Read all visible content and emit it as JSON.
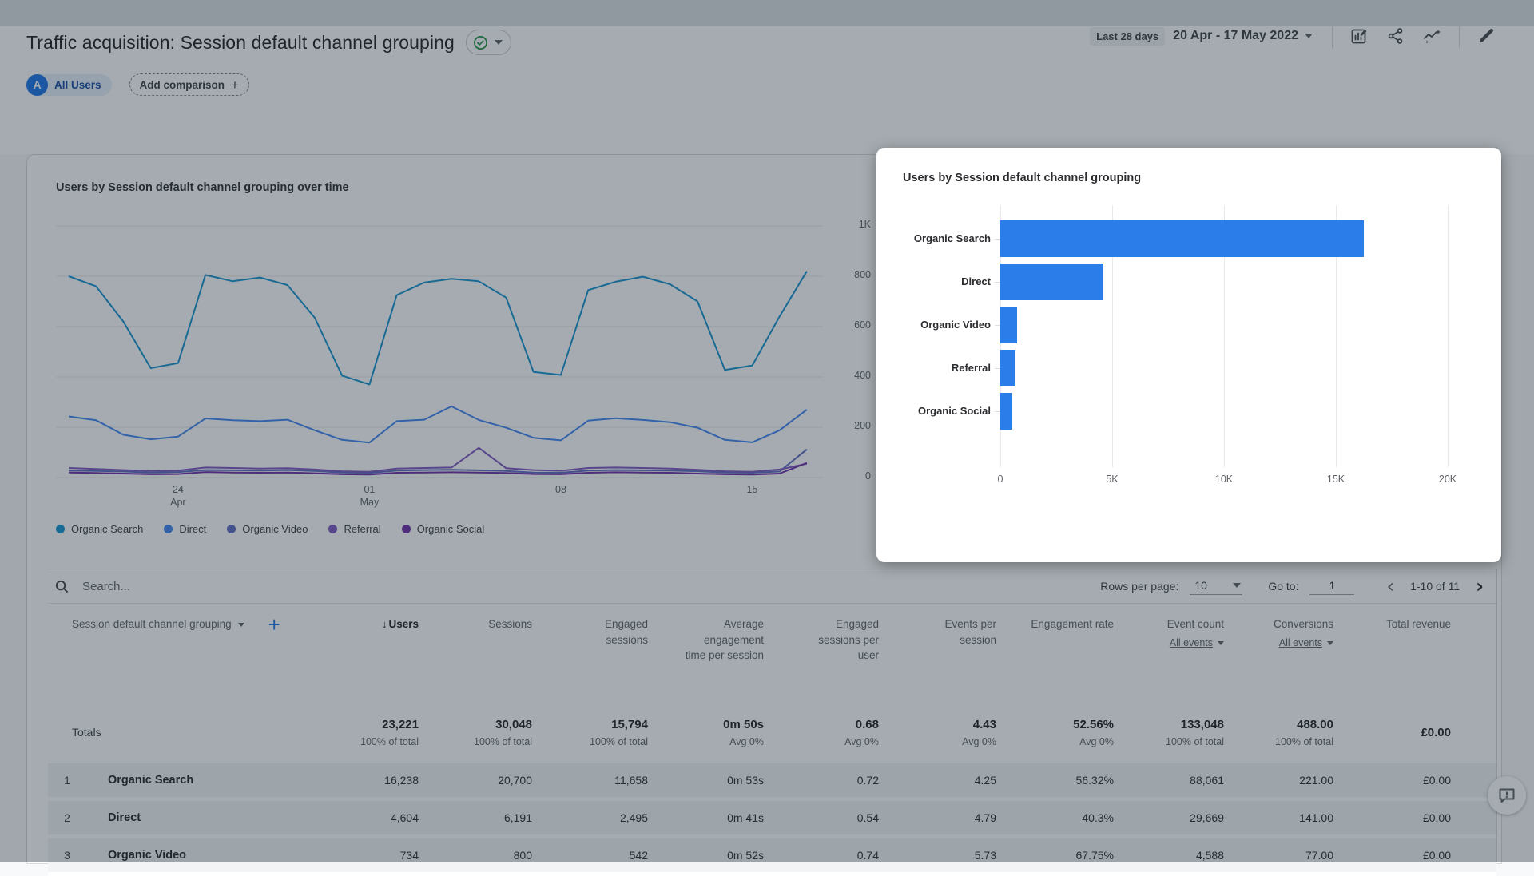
{
  "header": {
    "title": "Traffic acquisition: Session default channel grouping",
    "status_icon": "check-circle-icon",
    "date_preset": "Last 28 days",
    "date_range": "20 Apr - 17 May 2022",
    "audience_letter": "A",
    "audience_chip": "All Users",
    "add_comparison": "Add comparison",
    "toolbar_icons": [
      "customize-report-icon",
      "share-icon",
      "insights-icon",
      "edit-icon"
    ]
  },
  "chart_data": [
    {
      "type": "line",
      "title": "Users by Session default channel grouping over time",
      "ylabel": "Users",
      "ylim": [
        0,
        1000
      ],
      "y_ticks": [
        {
          "v": 1000,
          "label": "1K"
        },
        {
          "v": 800,
          "label": "800"
        },
        {
          "v": 600,
          "label": "600"
        },
        {
          "v": 400,
          "label": "400"
        },
        {
          "v": 200,
          "label": "200"
        },
        {
          "v": 0,
          "label": "0"
        }
      ],
      "x_ticks": [
        {
          "i": 4,
          "l1": "24",
          "l2": "Apr"
        },
        {
          "i": 11,
          "l1": "01",
          "l2": "May"
        },
        {
          "i": 18,
          "l1": "08",
          "l2": ""
        },
        {
          "i": 25,
          "l1": "15",
          "l2": ""
        }
      ],
      "grid": true,
      "legend_position": "bottom",
      "series": [
        {
          "name": "Organic Search",
          "color": "#1493d0",
          "values": [
            800,
            760,
            620,
            435,
            455,
            805,
            780,
            795,
            765,
            635,
            405,
            370,
            725,
            775,
            790,
            780,
            715,
            420,
            408,
            745,
            778,
            798,
            768,
            700,
            428,
            445,
            640,
            820
          ]
        },
        {
          "name": "Direct",
          "color": "#4285f4",
          "values": [
            243,
            228,
            170,
            152,
            163,
            235,
            228,
            224,
            230,
            188,
            150,
            139,
            224,
            230,
            283,
            229,
            198,
            158,
            148,
            226,
            236,
            229,
            220,
            198,
            150,
            140,
            188,
            270
          ]
        },
        {
          "name": "Organic Video",
          "color": "#5c6bc0",
          "values": [
            28,
            26,
            24,
            20,
            22,
            30,
            29,
            28,
            30,
            26,
            20,
            18,
            28,
            30,
            31,
            29,
            26,
            20,
            19,
            28,
            30,
            29,
            28,
            25,
            20,
            19,
            24,
            112
          ]
        },
        {
          "name": "Referral",
          "color": "#7e57c2",
          "values": [
            38,
            34,
            30,
            26,
            28,
            40,
            38,
            36,
            37,
            32,
            25,
            23,
            36,
            38,
            40,
            118,
            37,
            30,
            27,
            38,
            40,
            38,
            36,
            31,
            25,
            23,
            32,
            55
          ]
        },
        {
          "name": "Organic Social",
          "color": "#6f2da8",
          "values": [
            20,
            18,
            16,
            13,
            14,
            22,
            20,
            19,
            20,
            17,
            13,
            12,
            19,
            20,
            21,
            20,
            18,
            14,
            13,
            19,
            21,
            20,
            19,
            16,
            13,
            12,
            16,
            58
          ]
        }
      ]
    },
    {
      "type": "bar",
      "title": "Users by Session default channel grouping",
      "orientation": "horizontal",
      "categories": [
        "Organic Search",
        "Direct",
        "Organic Video",
        "Referral",
        "Organic Social"
      ],
      "values": [
        16238,
        4604,
        734,
        660,
        540
      ],
      "bar_color": "#2b7de9",
      "xlim": [
        0,
        20000
      ],
      "x_ticks": [
        {
          "v": 0,
          "label": "0"
        },
        {
          "v": 5000,
          "label": "5K"
        },
        {
          "v": 10000,
          "label": "10K"
        },
        {
          "v": 15000,
          "label": "15K"
        },
        {
          "v": 20000,
          "label": "20K"
        }
      ],
      "grid": true
    }
  ],
  "table": {
    "search_placeholder": "Search...",
    "rows_per_page_label": "Rows per page:",
    "rows_per_page_value": "10",
    "goto_label": "Go to:",
    "goto_value": "1",
    "range_text": "1-10 of 11",
    "prev_icon": "chevron-left-icon",
    "next_icon": "chevron-right-icon",
    "columns": [
      {
        "label": "Session default channel grouping",
        "type": "dimension"
      },
      {
        "label": "Users",
        "sorted": "desc"
      },
      {
        "label": "Sessions"
      },
      {
        "label": "Engaged sessions"
      },
      {
        "label": "Average engagement time per session"
      },
      {
        "label": "Engaged sessions per user"
      },
      {
        "label": "Events per session"
      },
      {
        "label": "Engagement rate"
      },
      {
        "label": "Event count",
        "sub": "All events"
      },
      {
        "label": "Conversions",
        "sub": "All events"
      },
      {
        "label": "Total revenue"
      }
    ],
    "totals": {
      "label": "Totals",
      "cells": [
        {
          "v": "23,221",
          "sub": "100% of total"
        },
        {
          "v": "30,048",
          "sub": "100% of total"
        },
        {
          "v": "15,794",
          "sub": "100% of total"
        },
        {
          "v": "0m 50s",
          "sub": "Avg 0%"
        },
        {
          "v": "0.68",
          "sub": "Avg 0%"
        },
        {
          "v": "4.43",
          "sub": "Avg 0%"
        },
        {
          "v": "52.56%",
          "sub": "Avg 0%"
        },
        {
          "v": "133,048",
          "sub": "100% of total"
        },
        {
          "v": "488.00",
          "sub": "100% of total"
        },
        {
          "v": "£0.00",
          "sub": ""
        }
      ]
    },
    "rows": [
      {
        "index": "1",
        "channel": "Organic Search",
        "values": [
          "16,238",
          "20,700",
          "11,658",
          "0m 53s",
          "0.72",
          "4.25",
          "56.32%",
          "88,061",
          "221.00",
          "£0.00"
        ]
      },
      {
        "index": "2",
        "channel": "Direct",
        "values": [
          "4,604",
          "6,191",
          "2,495",
          "0m 41s",
          "0.54",
          "4.79",
          "40.3%",
          "29,669",
          "141.00",
          "£0.00"
        ]
      },
      {
        "index": "3",
        "channel": "Organic Video",
        "values": [
          "734",
          "800",
          "542",
          "0m 52s",
          "0.74",
          "5.73",
          "67.75%",
          "4,588",
          "77.00",
          "£0.00"
        ]
      }
    ]
  },
  "feedback_icon": "feedback-bubble-icon"
}
